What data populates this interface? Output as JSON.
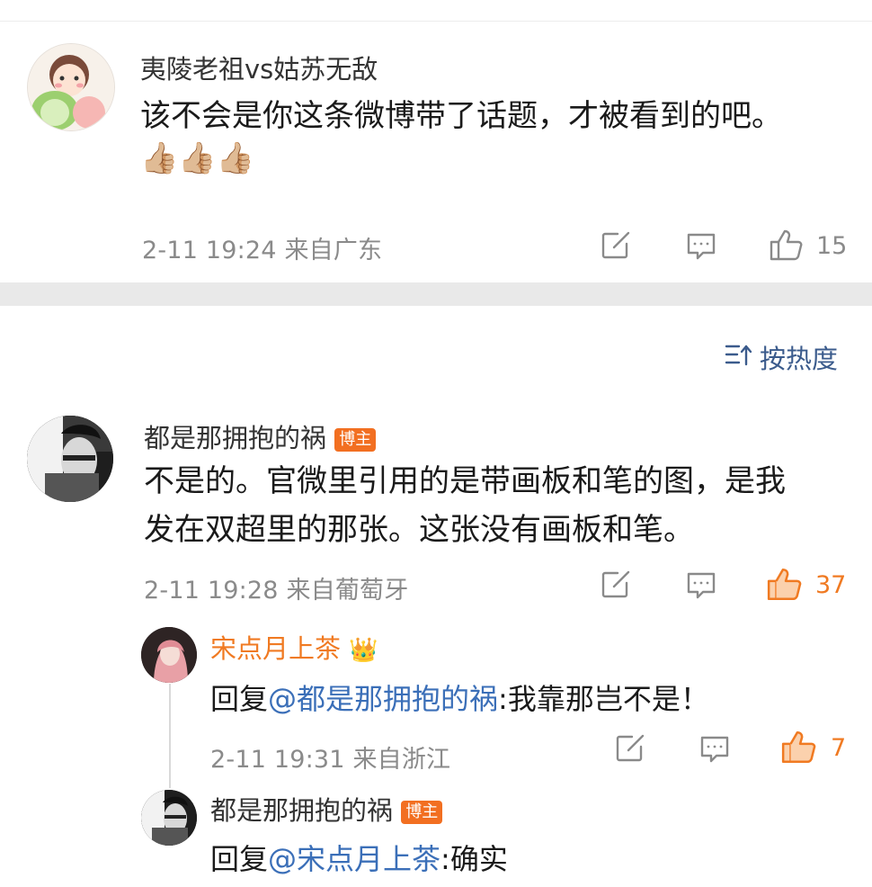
{
  "comment1": {
    "username": "夷陵老祖vs姑苏无敌",
    "text": "该不会是你这条微博带了话题，才被看到的吧。",
    "emoji": "👍🏼👍🏼👍🏼",
    "meta": "2-11 19:24  来自广东",
    "likes": "15"
  },
  "sort": {
    "icon": "sort-icon",
    "label": "按热度"
  },
  "comment2": {
    "username": "都是那拥抱的祸",
    "badge": "博主",
    "text_line1": "不是的。官微里引用的是带画板和笔的图，是我",
    "text_line2": "发在双超里的那张。这张没有画板和笔。",
    "meta": "2-11 19:28  来自葡萄牙",
    "likes": "37"
  },
  "reply1": {
    "username": "宋点月上茶",
    "crown": "👑",
    "prefix": "回复",
    "mention": "@都是那拥抱的祸",
    "text": ":我靠那岂不是！",
    "meta": "2-11 19:31  来自浙江",
    "likes": "7"
  },
  "reply2": {
    "username": "都是那拥抱的祸",
    "badge": "博主",
    "prefix": "回复",
    "mention": "@宋点月上茶",
    "text": ":确实"
  },
  "colors": {
    "accent_orange": "#f07a22",
    "mention_blue": "#3b6fb8",
    "meta_gray": "#8a8a8a"
  }
}
